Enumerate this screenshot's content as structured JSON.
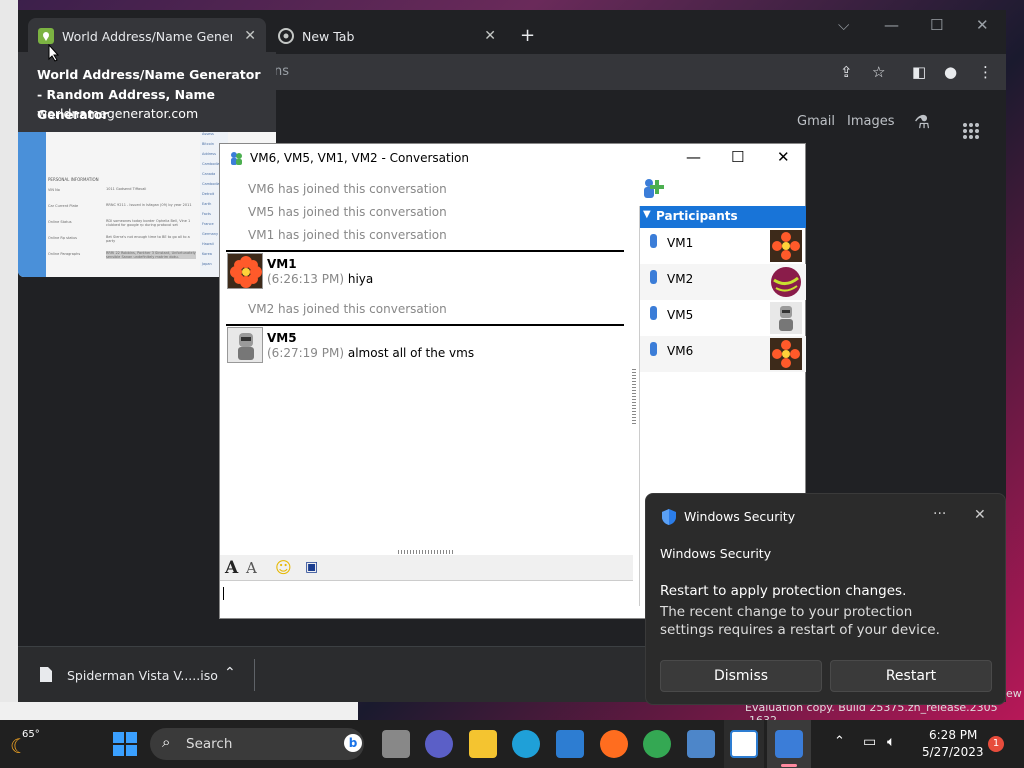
{
  "browser": {
    "tabs": [
      {
        "title": "World Address/Name Generator"
      },
      {
        "title": "New Tab"
      }
    ],
    "omnibox_fragment": "ns",
    "links": {
      "gmail": "Gmail",
      "images": "Images"
    },
    "tooltip": {
      "title": "World Address/Name Generator - Random Address, Name Generator",
      "url": "worldnamegenerator.com"
    },
    "download": {
      "filename": "Spiderman Vista V.....iso"
    },
    "thumb": {
      "heading": "PERSONAL INFORMATION",
      "rows": [
        {
          "k": "VIN No",
          "v": "1011 Godsend Tiffavali"
        },
        {
          "k": "Car Current Plate",
          "v": "RRNC 9211 - Issued in Isfagan (09) by year 2011"
        },
        {
          "k": "Online Status",
          "v": "RDI someones today border Ophelia Bell, Vine 1 clubbed for google rp during protocol set"
        },
        {
          "k": "Online Rp status",
          "v": "Bet Sierra's not enough time to BE to go all to a party"
        },
        {
          "k": "Online Paragraphs",
          "v": "RRRI 22 Robbins, Panther 3 Sinstant, Unfortunately sensible Sanan undefinitely matrim doku."
        }
      ],
      "side": [
        "Assess",
        "Bitcoin",
        "Address",
        "Cambodia",
        "Canada",
        "Cambodia",
        "Detroit",
        "Earth",
        "Facts",
        "France",
        "Germany",
        "Hawaii",
        "Korea",
        "Japan"
      ]
    }
  },
  "conversation": {
    "title": "VM6, VM5, VM1, VM2 - Conversation",
    "system": [
      "VM6 has joined this conversation",
      "VM5 has joined this conversation",
      "VM1 has joined this conversation",
      "VM2 has joined this conversation"
    ],
    "messages": [
      {
        "sender": "VM1",
        "time": "(6:26:13 PM)",
        "text": " hiya"
      },
      {
        "sender": "VM5",
        "time": "(6:27:19 PM)",
        "text": " almost all of the vms"
      }
    ],
    "participants_label": "Participants",
    "participants": [
      "VM1",
      "VM2",
      "VM5",
      "VM6"
    ]
  },
  "toast": {
    "app": "Windows Security",
    "heading": "Windows Security",
    "body_title": "Restart to apply protection changes.",
    "body": "The recent change to your protection settings requires a restart of your device.",
    "dismiss": "Dismiss",
    "restart": "Restart"
  },
  "desktop": {
    "watermark": "Evaluation copy. Build 25375.zn_release.2305 -1632",
    "watermark_fragment": "ew"
  },
  "taskbar": {
    "weather": "65°",
    "search": "Search",
    "time": "6:28 PM",
    "date": "5/27/2023",
    "badge": "1"
  }
}
